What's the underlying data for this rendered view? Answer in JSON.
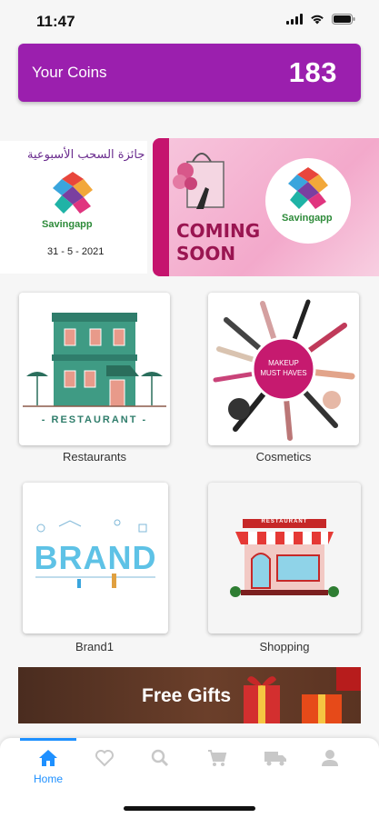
{
  "status_bar": {
    "time": "11:47",
    "icons": [
      "signal-icon",
      "wifi-icon",
      "battery-icon"
    ]
  },
  "coins": {
    "label": "Your Coins",
    "value": "183",
    "color": "#9b1fae"
  },
  "banners": [
    {
      "arabic_title": "جائزة السحب الأسبوعية",
      "brand": "Savingapp",
      "date": "31 - 5 - 2021"
    },
    {
      "headline_line1": "COMING",
      "headline_line2": "SOON",
      "brand": "Savingapp"
    }
  ],
  "categories": [
    {
      "label": "Restaurants",
      "art_text": "- RESTAURANT -"
    },
    {
      "label": "Cosmetics",
      "art_text_line1": "MAKEUP",
      "art_text_line2": "MUST HAVES"
    },
    {
      "label": "Brand1",
      "art_text": "BRAND"
    },
    {
      "label": "Shopping",
      "art_text": "RESTAURANT"
    }
  ],
  "free_gifts": {
    "label": "Free Gifts"
  },
  "bottom_nav": {
    "active_color": "#1e90ff",
    "items": [
      {
        "icon": "home-icon",
        "label": "Home",
        "active": true
      },
      {
        "icon": "heart-icon",
        "active": false
      },
      {
        "icon": "search-icon",
        "active": false
      },
      {
        "icon": "cart-icon",
        "active": false
      },
      {
        "icon": "truck-icon",
        "active": false
      },
      {
        "icon": "person-icon",
        "active": false
      }
    ]
  }
}
